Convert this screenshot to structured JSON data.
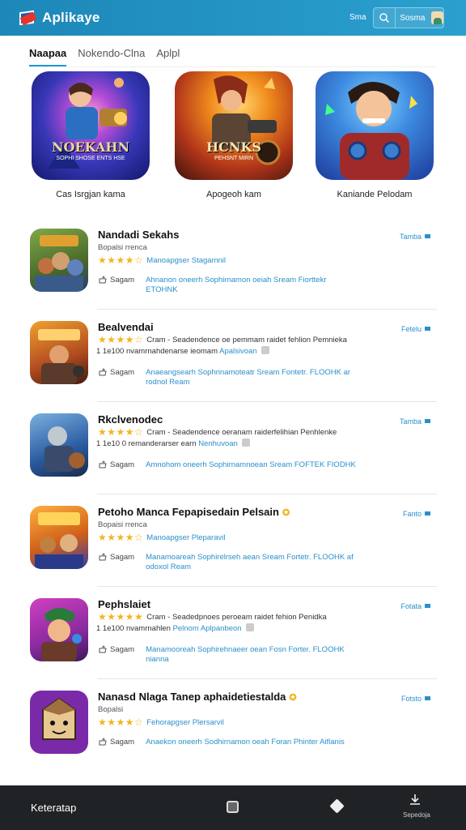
{
  "header": {
    "title": "Aplikaye",
    "link_label": "Sma",
    "user_label": "Sosma",
    "accent": "#1d87b8"
  },
  "tabs": [
    {
      "label": "Naapaa",
      "active": true
    },
    {
      "label": "Nokendo-Clna",
      "active": false
    },
    {
      "label": "Aplpl",
      "active": false
    }
  ],
  "featured": [
    {
      "art_title": "NOEKAHN",
      "art_sub": "SOPHI SHOSE ENTS  HSE",
      "caption": "Cas Isrgjan kama"
    },
    {
      "art_title": "HCNKS",
      "art_sub": "PEHSNT  MIRN",
      "caption": "Apogeoh kam"
    },
    {
      "art_title": "",
      "art_sub": "",
      "caption": "Kaniande Pelodam"
    }
  ],
  "list": [
    {
      "title": "Nandadi Sekahs",
      "subtitle": "Bopalsi rrenca",
      "rating_text": "Manoapgser Stagamnil",
      "extra": "",
      "extra_link": "",
      "save": "Sagam",
      "links": "Ahnanon oneerh Sophirnamon oeiah Sream Fiorttekr ETOHNK",
      "badge": "Tamba",
      "verified": false
    },
    {
      "title": "Bealvendai",
      "subtitle": "",
      "rating_text": "Cram - Seadendence oe pemmam raidet fehlion Pemnieka",
      "extra": "1 1e100 nvamrnahdenarse ieomam",
      "extra_link": "Apalsivoan",
      "save": "Sagam",
      "links": "Anaeangsearh Sophrinamoteatr Sream Fontetr. FLOOHK ar rodnol Ream",
      "badge": "Fetelu",
      "verified": false
    },
    {
      "title": "Rkclvenodec",
      "subtitle": "",
      "rating_text": "Cram - Seadendence oeranam raiderfelihian Penhlenke",
      "extra": "1 1e10 0 remanderarser earn",
      "extra_link": "Nenhuvoan",
      "save": "Sagam",
      "links": "Amnohom oneerh Sophirnamnoean Sream FOFTEK FIODHK",
      "badge": "Tamba",
      "verified": false
    },
    {
      "title": "Petoho Manca Fepapisedain Pelsain",
      "subtitle": "Bopaisi rrenca",
      "rating_text": "Manoapgser Pleparavil",
      "extra": "",
      "extra_link": "",
      "save": "Sagam",
      "links": "Manamoareah Sophirelrseh aean Sream Fortetr. FLOOHK af odoxol Ream",
      "badge": "Fanto",
      "verified": true
    },
    {
      "title": "Pephslaiet",
      "subtitle": "",
      "rating_text": "Cram - Seadedpnoes peroeam raidet fehion Penidka",
      "extra": "1 1e100 nvamrnahlen",
      "extra_link": "Pelnom Aplpanbeon",
      "save": "Sagam",
      "links": "Manamooreah Sophirehnaeer oean Fosn Forter. FLOOHK nianna",
      "badge": "Fotata",
      "verified": false
    },
    {
      "title": "Nanasd Nlaga Tanep aphaidetiestalda",
      "subtitle": "Bopalsi",
      "rating_text": "Fehorapgser Plersarvil",
      "extra": "",
      "extra_link": "",
      "save": "Sagam",
      "links": "Anaekon oneerh Sodhirnamon oeah Foran Phinter Aiflanis",
      "badge": "Fotsto",
      "verified": true
    }
  ],
  "bottom": {
    "label": "Keteratap",
    "download_label": "Sepedoja"
  }
}
